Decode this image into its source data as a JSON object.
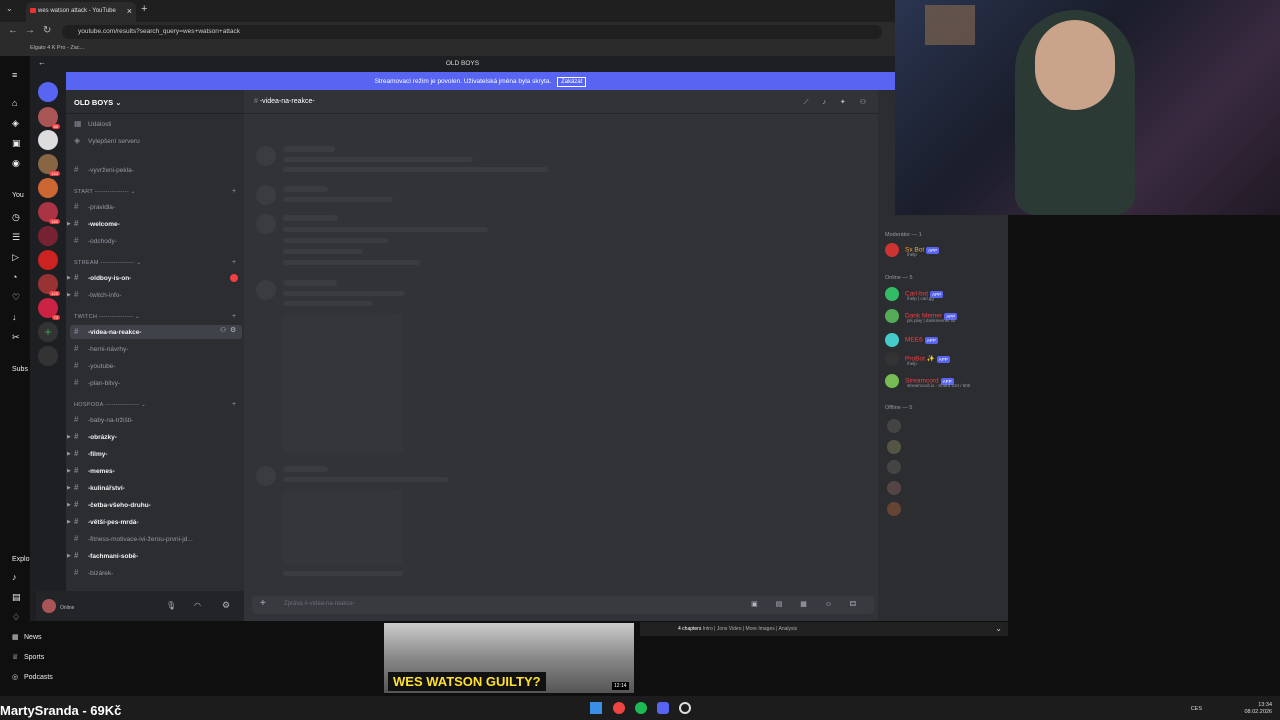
{
  "browser": {
    "tab_title": "wes watson attack - YouTube",
    "url": "youtube.com/results?search_query=wes+watson+attack",
    "bookmark": "Elgato 4 K Pro - Zac..."
  },
  "youtube": {
    "you_label": "You",
    "subs_label": "Subs",
    "explore_label": "Explo",
    "nav": [
      "News",
      "Sports",
      "Podcasts"
    ],
    "channel_watermark": "MartySranda - 69Kč",
    "video_title_overlay": "WES WATSON GUILTY?",
    "video_duration": "12:14",
    "chapters_text": "4 chapters",
    "chapters_list": "Intro | Jons Video | More Images | Analysis"
  },
  "discord": {
    "window_title": "OLD BOYS",
    "banner_text": "Streamovací režim je povolen. Uživatelská jména byla skryta.",
    "banner_button": "Zakázat",
    "server_name": "OLD BOYS",
    "events": "Události",
    "boost": "Vylepšení serveru",
    "categories": {
      "start": "START",
      "stream": "STREAM",
      "twitch": "TWITCH",
      "hospoda": "HOSPODA"
    },
    "channels": {
      "vyvrzeni": "-vyvrženi-pekla-",
      "pravidla": "-pravidla-",
      "welcome": "-welcome-",
      "odchody": "-odchody-",
      "oldboy": "-oldboy-is-on-",
      "twitch_info": "-twitch-info-",
      "videa": "-videa-na-reakce-",
      "herni": "-herni-návrhy-",
      "youtube": "-youtube-",
      "plan": "-plan-bitvy-",
      "baby": "-baby-na-tržišti-",
      "obrazky": "-obrázky-",
      "filmy": "-filmy-",
      "memes": "-memes-",
      "kulinarstvi": "-kulinářství-",
      "cetba": "-četba-všeho-druhu-",
      "vetsi": "-větší-pes-mrdá-",
      "fitness": "-fitness-motivace-ivi-žerou-prvni-jd...",
      "fachmani": "-fachmani-sobě-",
      "bizarek": "-bizárek-"
    },
    "user_status": "Online",
    "chat_channel": "-videa-na-reakce-",
    "input_placeholder": "Zpráva #-videa-na-reakce-",
    "member_groups": {
      "mod": "Moderátor — 1",
      "online": "Online — 5",
      "offline": "Offline — 5"
    },
    "members": [
      {
        "name": "Sx Bot",
        "sub": "/help",
        "color": "#f2a63a"
      },
      {
        "name": "Carl-bot",
        "sub": "/help | carl.gg",
        "color": "#f23f43"
      },
      {
        "name": "Dank Memer",
        "sub": "pls play | dankmemer.lol",
        "color": "#f23f43"
      },
      {
        "name": "MEE6",
        "sub": "",
        "color": "#f23f43"
      },
      {
        "name": "ProBot ✨",
        "sub": "/help",
        "color": "#f23f43"
      },
      {
        "name": "Streamcord",
        "sub": "streamcord.io - Shard 234 / 600",
        "color": "#f23f43"
      }
    ],
    "app_badge": "APP"
  },
  "system": {
    "time": "13:34",
    "date": "08.02.2026",
    "lang": "CES"
  }
}
